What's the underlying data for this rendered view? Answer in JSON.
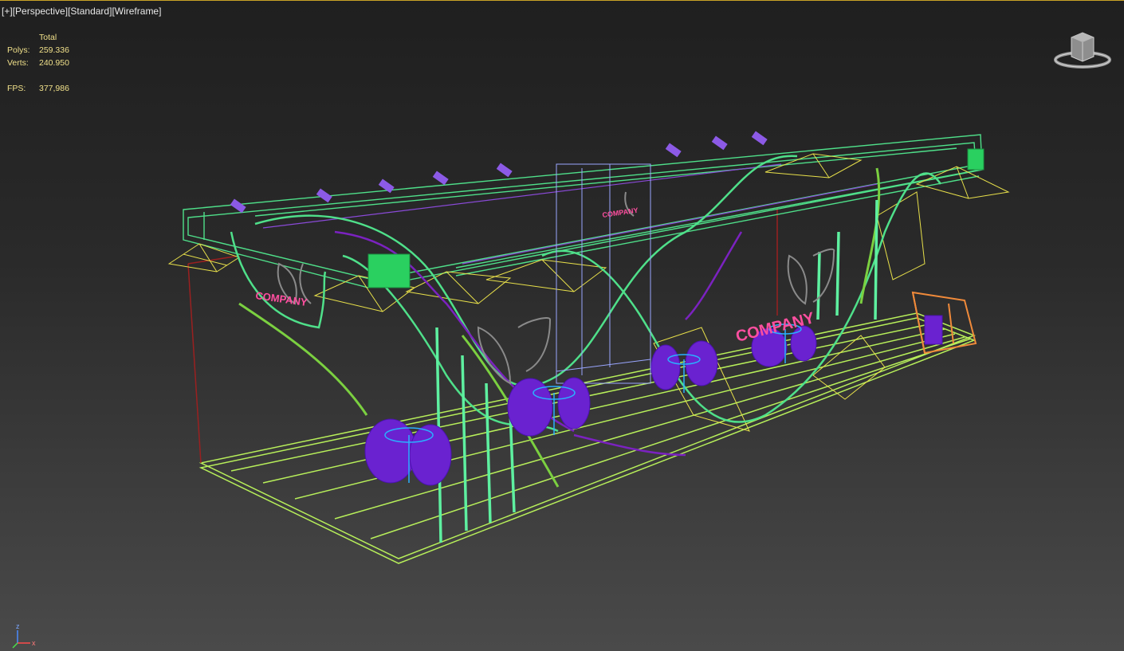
{
  "viewport": {
    "labels": [
      "[+]",
      "[Perspective]",
      "[Standard]",
      "[Wireframe]"
    ]
  },
  "stats": {
    "header": "Total",
    "polys_label": "Polys:",
    "polys_value": "259.336",
    "verts_label": "Verts:",
    "verts_value": "240.950",
    "fps_label": "FPS:",
    "fps_value": "377,986"
  },
  "scene": {
    "booth_signs": [
      "COMPANY",
      "COMPANY",
      "COMPANY"
    ]
  },
  "axis": {
    "z_label": "z",
    "x_label": "x"
  },
  "colors": {
    "stats_text": "#f0e08a",
    "wire_green": "#6de86d",
    "wire_yellow": "#e8e04a",
    "wire_purple": "#7b2fd0",
    "sign_pink": "#ff4fa0",
    "frame_top": "#c9a227"
  }
}
